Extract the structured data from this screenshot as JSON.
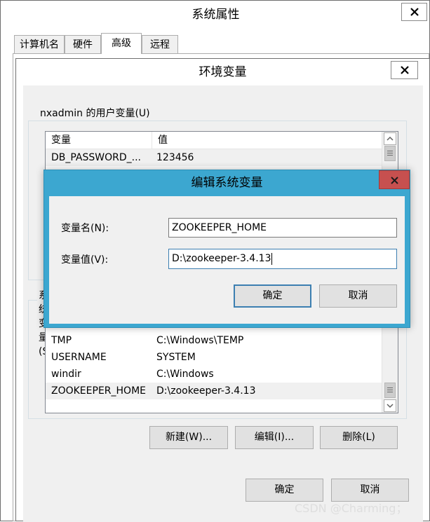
{
  "sys_props": {
    "title": "系统属性",
    "tabs": [
      {
        "label": "计算机名"
      },
      {
        "label": "硬件"
      },
      {
        "label": "高级"
      },
      {
        "label": "远程"
      }
    ],
    "active_tab": "高级"
  },
  "env_vars": {
    "title": "环境变量",
    "user_group_label": "nxadmin 的用户变量(U)",
    "sys_group_label": "系统变量(S)",
    "columns": {
      "name": "变量",
      "value": "值"
    },
    "user_rows": [
      {
        "name": "DB_PASSWORD_...",
        "value": "123456"
      }
    ],
    "system_rows": [
      {
        "name": "TMP",
        "value": "C:\\Windows\\TEMP"
      },
      {
        "name": "USERNAME",
        "value": "SYSTEM"
      },
      {
        "name": "windir",
        "value": "C:\\Windows"
      },
      {
        "name": "ZOOKEEPER_HOME",
        "value": "D:\\zookeeper-3.4.13"
      }
    ],
    "selected_system_row": "ZOOKEEPER_HOME",
    "buttons": {
      "new": "新建(W)...",
      "edit": "编辑(I)...",
      "delete": "删除(L)"
    },
    "ok": "确定",
    "cancel": "取消"
  },
  "edit_dialog": {
    "title": "编辑系统变量",
    "name_label": "变量名(N):",
    "value_label": "变量值(V):",
    "name_value": "ZOOKEEPER_HOME",
    "value_value": "D:\\zookeeper-3.4.13",
    "ok": "确定",
    "cancel": "取消"
  },
  "watermark": "CSDN @Charming；",
  "colors": {
    "dialog_frame": "#3ca7d0",
    "close_button_red": "#c7504f",
    "focus_border": "#3c7fb1"
  },
  "icons": {
    "close": "close-icon",
    "scroll_up": "chevron-up-icon",
    "scroll_down": "chevron-down-icon"
  }
}
